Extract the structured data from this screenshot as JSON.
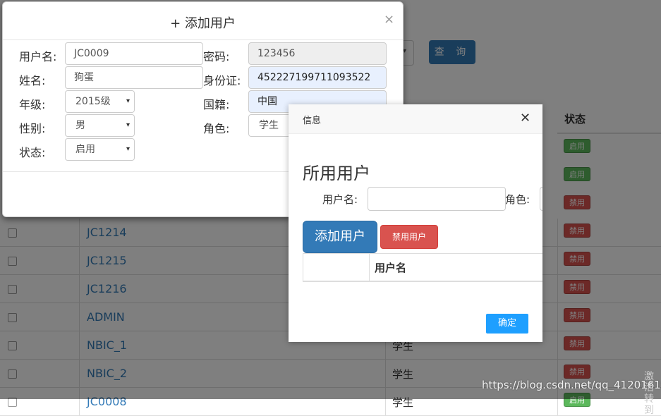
{
  "background": {
    "query_button": "查 询",
    "status_header": "状态",
    "caret": "▾",
    "top_badges": [
      {
        "text": "启用",
        "color": "#5cb85c"
      },
      {
        "text": "启用",
        "color": "#5cb85c"
      },
      {
        "text": "禁用",
        "color": "#d9534f"
      }
    ],
    "rows": [
      {
        "user": "JC1214",
        "role": "",
        "status": "禁用"
      },
      {
        "user": "JC1215",
        "role": "",
        "status": "禁用"
      },
      {
        "user": "JC1216",
        "role": "",
        "status": "禁用"
      },
      {
        "user": "ADMIN",
        "role": "",
        "status": "禁用"
      },
      {
        "user": "NBIC_1",
        "role": "学生",
        "status": "禁用"
      },
      {
        "user": "NBIC_2",
        "role": "学生",
        "status": "禁用"
      },
      {
        "user": "JC0008",
        "role": "学生",
        "status": "启用"
      }
    ]
  },
  "add_modal": {
    "title": "+ 添加用户",
    "close": "×",
    "username_label": "用户名:",
    "username_value": "JC0009",
    "password_label": "密码:",
    "password_value": "123456",
    "name_label": "姓名:",
    "name_value": "狗蛋",
    "id_label": "身份证:",
    "id_value": "452227199711093522",
    "grade_label": "年级:",
    "grade_value": "2015级",
    "nationality_label": "国籍:",
    "nationality_value": "中国",
    "gender_label": "性别:",
    "gender_value": "男",
    "role_label": "角色:",
    "role_value": "学生",
    "status_label": "状态:",
    "status_value": "启用"
  },
  "info_dialog": {
    "title": "信息",
    "close": "✕",
    "heading": "所用用户",
    "username_label": "用户名:",
    "role_label": "角色:",
    "add_button": "添加用户",
    "disable_button": "禁用用户",
    "table_header_username": "用户名",
    "ok_button": "确定"
  },
  "watermark": "https://blog.csdn.net/qq_41201619",
  "corner_text": "激活 转到"
}
